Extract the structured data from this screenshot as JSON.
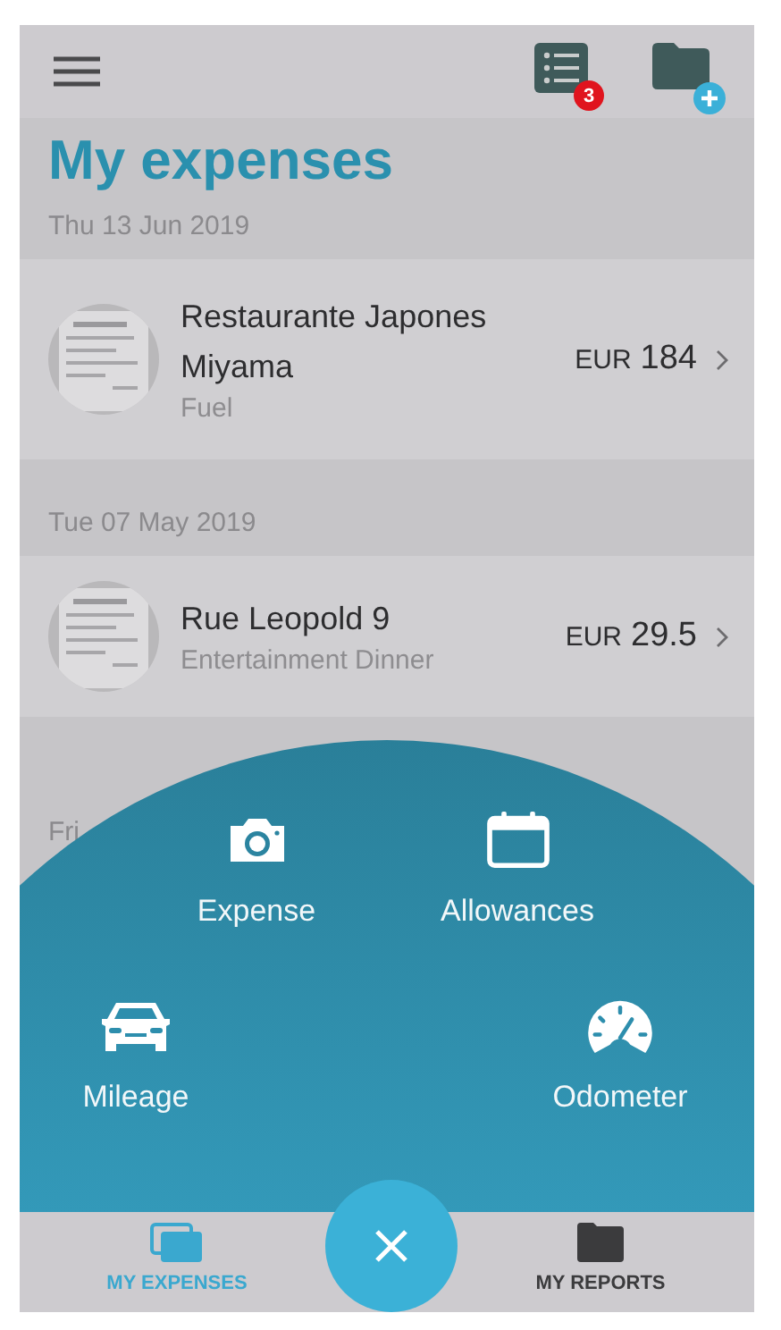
{
  "toolbar": {
    "badge": "3"
  },
  "title": "My expenses",
  "groups": [
    {
      "date": "Thu 13 Jun 2019",
      "expenses": [
        {
          "merchant": "Restaurante Japones Miyama",
          "category": "Fuel",
          "currency": "EUR",
          "amount": "184"
        }
      ]
    },
    {
      "date": "Tue 07 May 2019",
      "expenses": [
        {
          "merchant": "Rue Leopold 9",
          "category": "Entertainment Dinner",
          "currency": "EUR",
          "amount": "29.5"
        }
      ]
    },
    {
      "date": "Fri"
    }
  ],
  "action_menu": {
    "actions": [
      {
        "kind": "camera",
        "label": "Expense"
      },
      {
        "kind": "calendar",
        "label": "Allowances"
      },
      {
        "kind": "car",
        "label": "Mileage"
      },
      {
        "kind": "gauge",
        "label": "Odometer"
      }
    ]
  },
  "tabs": [
    {
      "kind": "stack",
      "label": "MY EXPENSES",
      "selected": true
    },
    {
      "kind": "folder",
      "label": "MY REPORTS",
      "selected": false
    }
  ]
}
